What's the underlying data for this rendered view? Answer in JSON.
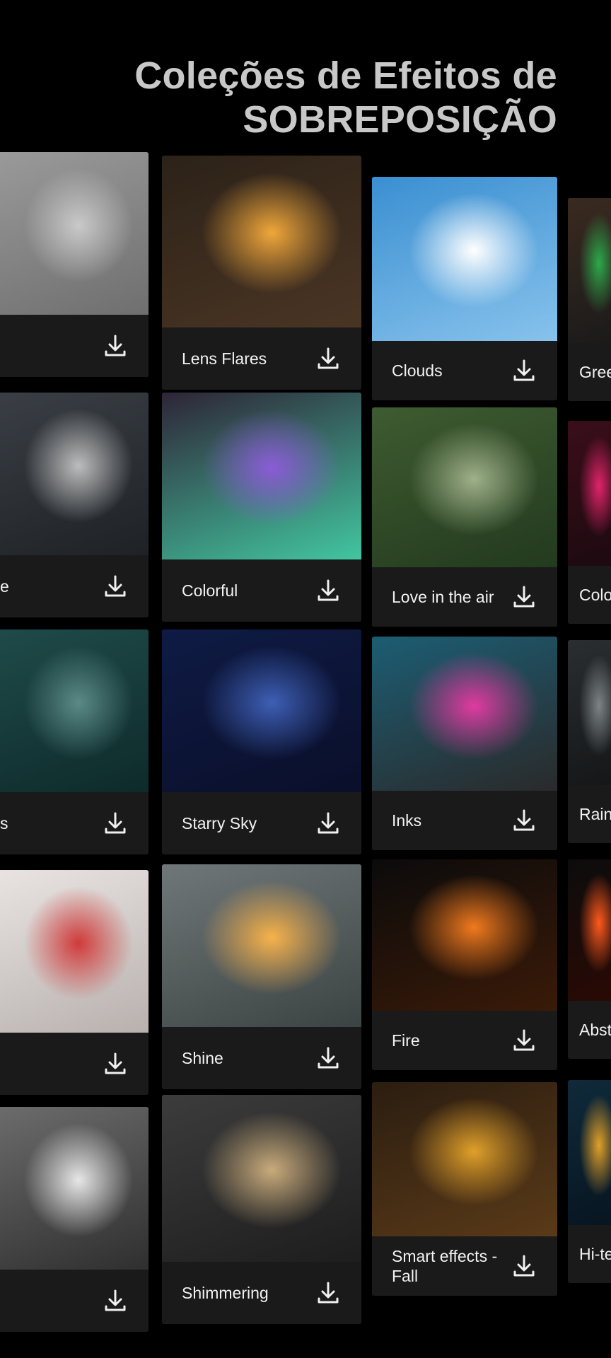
{
  "header": {
    "line1": "Coleções de Efeitos de",
    "line2": "SOBREPOSIÇÃO"
  },
  "columns": [
    {
      "cards": [
        {
          "label": "",
          "thumb_colors": [
            "#9a9a9a",
            "#c9c9c9",
            "#6f6f6f"
          ]
        },
        {
          "label": "e",
          "thumb_colors": [
            "#3a3f45",
            "#bdbdbd",
            "#1e2226"
          ]
        },
        {
          "label": "s",
          "thumb_colors": [
            "#1f4b4a",
            "#5b8a86",
            "#0e2a2a"
          ]
        },
        {
          "label": "",
          "thumb_colors": [
            "#e9e4e2",
            "#d03a3a",
            "#b8b1ae"
          ]
        },
        {
          "label": "",
          "thumb_colors": [
            "#6c6c6c",
            "#e7e7e7",
            "#2f2f2f"
          ]
        }
      ]
    },
    {
      "cards": [
        {
          "label": "Lens Flares",
          "thumb_colors": [
            "#2c2218",
            "#f0a73a",
            "#4a3524"
          ]
        },
        {
          "label": "Colorful",
          "thumb_colors": [
            "#2e2436",
            "#8b5bd6",
            "#42c6a0"
          ]
        },
        {
          "label": "Starry Sky",
          "thumb_colors": [
            "#0f1b45",
            "#3e5fb5",
            "#0a0f2a"
          ]
        },
        {
          "label": "Shine",
          "thumb_colors": [
            "#6f7778",
            "#f7b24a",
            "#3c4343"
          ]
        },
        {
          "label": "Shimmering",
          "thumb_colors": [
            "#3c3c3c",
            "#c9ab7b",
            "#1d1d1d"
          ]
        }
      ]
    },
    {
      "cards": [
        {
          "label": "Clouds",
          "thumb_colors": [
            "#3a8fd1",
            "#ffffff",
            "#87c2ec"
          ]
        },
        {
          "label": "Love in the air",
          "thumb_colors": [
            "#3e5b31",
            "#9fb08a",
            "#233a1e"
          ]
        },
        {
          "label": "Inks",
          "thumb_colors": [
            "#1c5d73",
            "#e03aa0",
            "#2a2a2a"
          ]
        },
        {
          "label": "Fire",
          "thumb_colors": [
            "#0b0b0b",
            "#f07a1e",
            "#3a1a08"
          ]
        },
        {
          "label": "Smart effects - Fall",
          "thumb_colors": [
            "#2b1d10",
            "#e0a02a",
            "#5a3a18"
          ]
        }
      ]
    },
    {
      "cards": [
        {
          "label": "Gree",
          "thumb_colors": [
            "#3a2a20",
            "#2ea84a",
            "#1a1a1a"
          ]
        },
        {
          "label": "Colo",
          "thumb_colors": [
            "#3a0e1a",
            "#e0246a",
            "#1c0a10"
          ]
        },
        {
          "label": "Rain",
          "thumb_colors": [
            "#2a2e30",
            "#7d8486",
            "#141618"
          ]
        },
        {
          "label": "Abst",
          "thumb_colors": [
            "#0c0c0c",
            "#ff5a1e",
            "#2a0a04"
          ]
        },
        {
          "label": "Hi-te",
          "thumb_colors": [
            "#0f2a3a",
            "#e0a02a",
            "#071520"
          ]
        }
      ]
    }
  ],
  "icons": {
    "download": "download-icon"
  }
}
